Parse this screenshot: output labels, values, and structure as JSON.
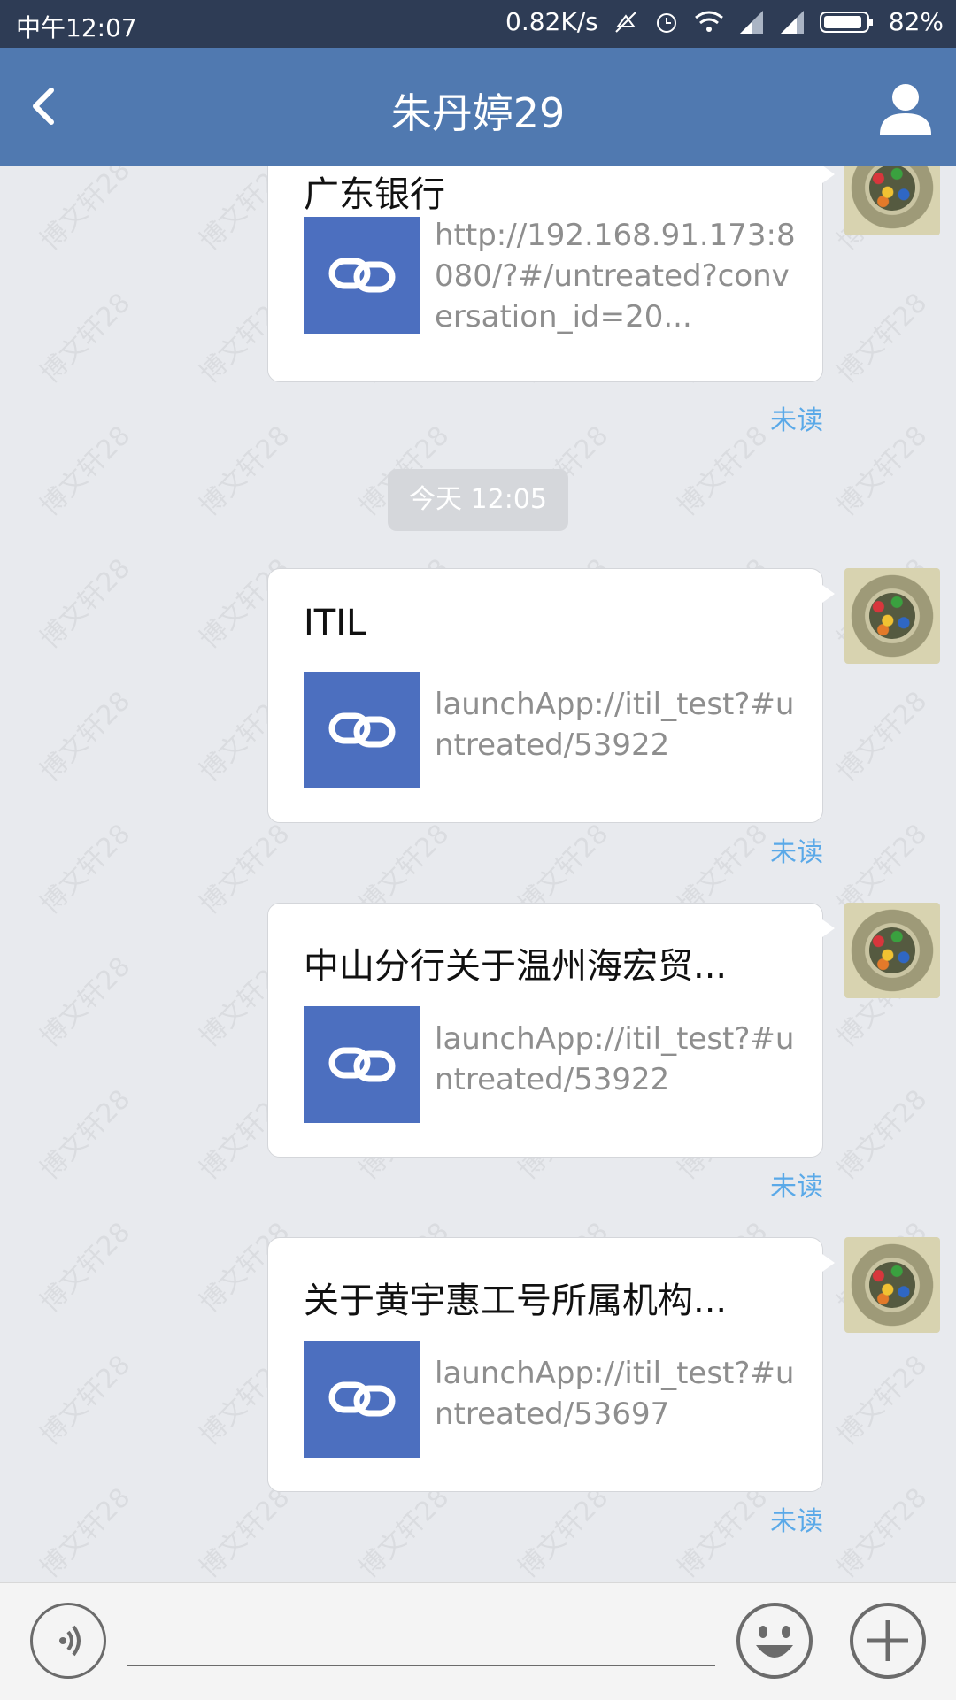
{
  "status_bar": {
    "time": "中午12:07",
    "net_speed": "0.82K/s",
    "battery": "82%"
  },
  "header": {
    "title": "朱丹婷29",
    "back_icon": "chevron-left-icon",
    "contact_icon": "person-icon"
  },
  "chat": {
    "watermark_text": "博文轩28",
    "timestamp": "今天 12:05",
    "messages": [
      {
        "title": "广东银行",
        "url": "http://192.168.91.173:8080/?#/untreated?conversation_id=20...",
        "status": "未读"
      },
      {
        "title": "ITIL",
        "url": "launchApp://itil_test?#untreated/53922",
        "status": "未读"
      },
      {
        "title": "中山分行关于温州海宏贸...",
        "url": "launchApp://itil_test?#untreated/53922",
        "status": "未读"
      },
      {
        "title": "关于黄宇惠工号所属机构...",
        "url": "launchApp://itil_test?#untreated/53697",
        "status": "未读"
      }
    ]
  },
  "input_bar": {
    "placeholder": "",
    "voice_icon": "voice-icon",
    "emoji_icon": "emoji-icon",
    "plus_icon": "plus-icon"
  },
  "colors": {
    "status_bar_bg": "#2e3c55",
    "header_bg": "#5079b0",
    "link_thumb_bg": "#4c6fbf",
    "unread_text": "#5aa9e8"
  }
}
